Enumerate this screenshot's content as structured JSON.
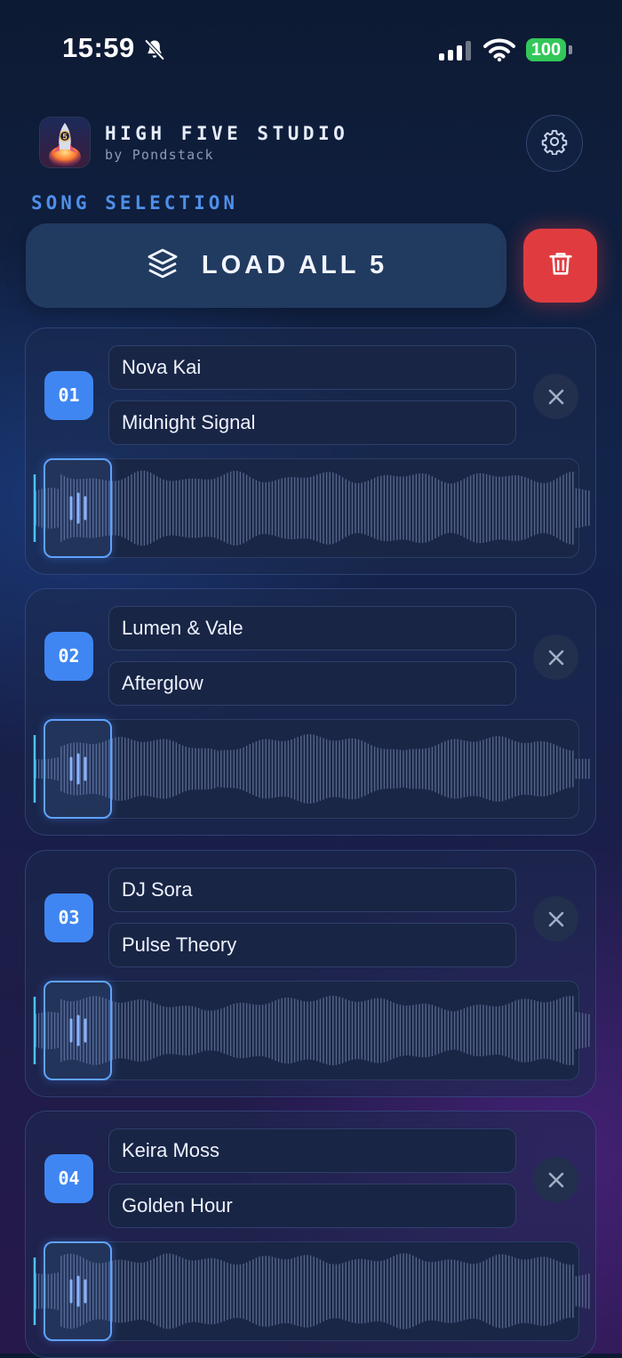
{
  "status_bar": {
    "time": "15:59",
    "battery": "100",
    "icons": [
      "bell-slash-icon",
      "signal-icon",
      "wifi-icon",
      "battery-icon"
    ]
  },
  "header": {
    "title": "HIGH FIVE STUDIO",
    "subtitle": "by Pondstack",
    "logo_badge": "5",
    "settings_icon": "gear-icon"
  },
  "section_label": "SONG SELECTION",
  "actions": {
    "load_all_label": "LOAD ALL 5",
    "load_all_icon": "layers-icon",
    "delete_icon": "trash-icon"
  },
  "songs": [
    {
      "number": "01",
      "artist": "Nova Kai",
      "title": "Midnight Signal"
    },
    {
      "number": "02",
      "artist": "Lumen & Vale",
      "title": "Afterglow"
    },
    {
      "number": "03",
      "artist": "DJ Sora",
      "title": "Pulse Theory"
    },
    {
      "number": "04",
      "artist": "Keira Moss",
      "title": "Golden Hour"
    }
  ],
  "colors": {
    "accent_blue": "#3f86f2",
    "section_label": "#4f8fe8",
    "danger_red": "#e03c40",
    "battery_green": "#33c759",
    "waveform": "#55658a",
    "playhead": "#4fc3f7"
  }
}
